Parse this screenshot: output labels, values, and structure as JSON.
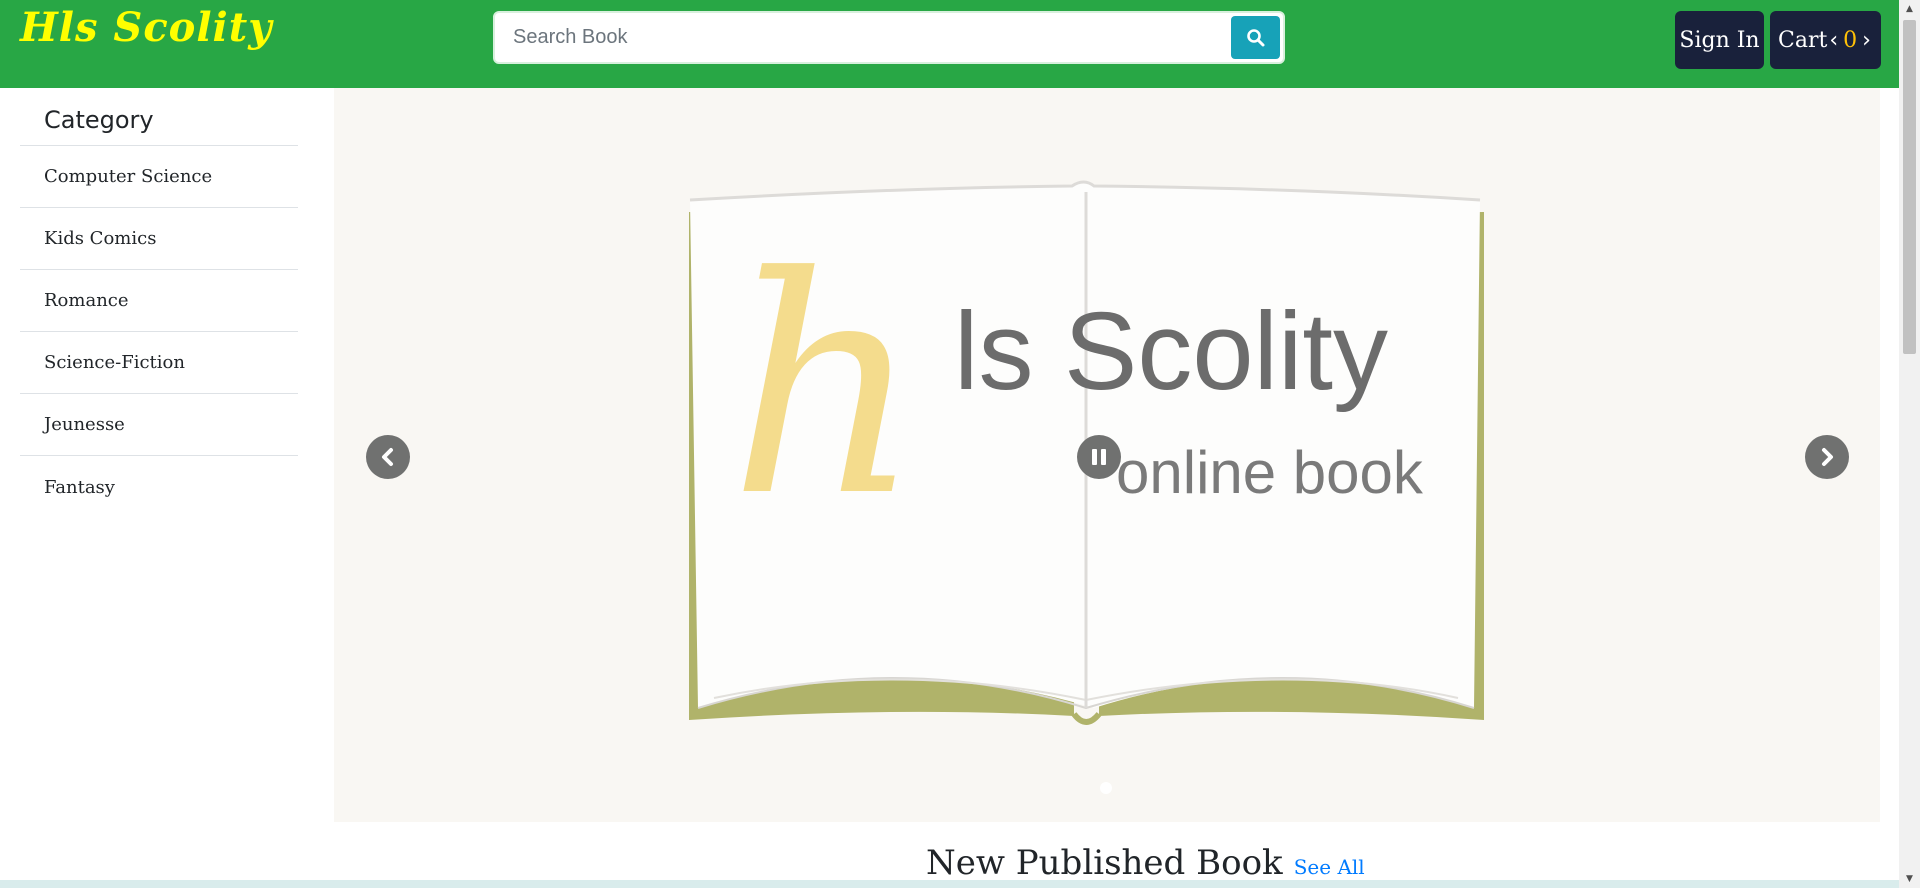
{
  "header": {
    "brand": "Hls Scolity",
    "search_placeholder": "Search Book",
    "signin_label": "Sign In",
    "cart_label": "Cart",
    "cart_count": "0"
  },
  "sidebar": {
    "title": "Category",
    "items": [
      {
        "label": "Computer Science"
      },
      {
        "label": "Kids Comics"
      },
      {
        "label": "Romance"
      },
      {
        "label": "Science-Fiction"
      },
      {
        "label": "Jeunesse"
      },
      {
        "label": "Fantasy"
      }
    ]
  },
  "carousel": {
    "slide": {
      "logo_letter": "h",
      "logo_text": "ls Scolity",
      "tagline": "online book"
    },
    "prev_icon": "chevron-left-icon",
    "next_icon": "chevron-right-icon",
    "pause_icon": "pause-icon"
  },
  "section": {
    "title": "New Published Book",
    "see_all": "See All"
  },
  "colors": {
    "header_bg": "#28a745",
    "brand": "#ffff00",
    "search_button": "#17a2b8",
    "dark_button": "#19213b",
    "cart_count": "#ffc107",
    "link": "#007bff",
    "book_cover": "#b0b36a"
  }
}
